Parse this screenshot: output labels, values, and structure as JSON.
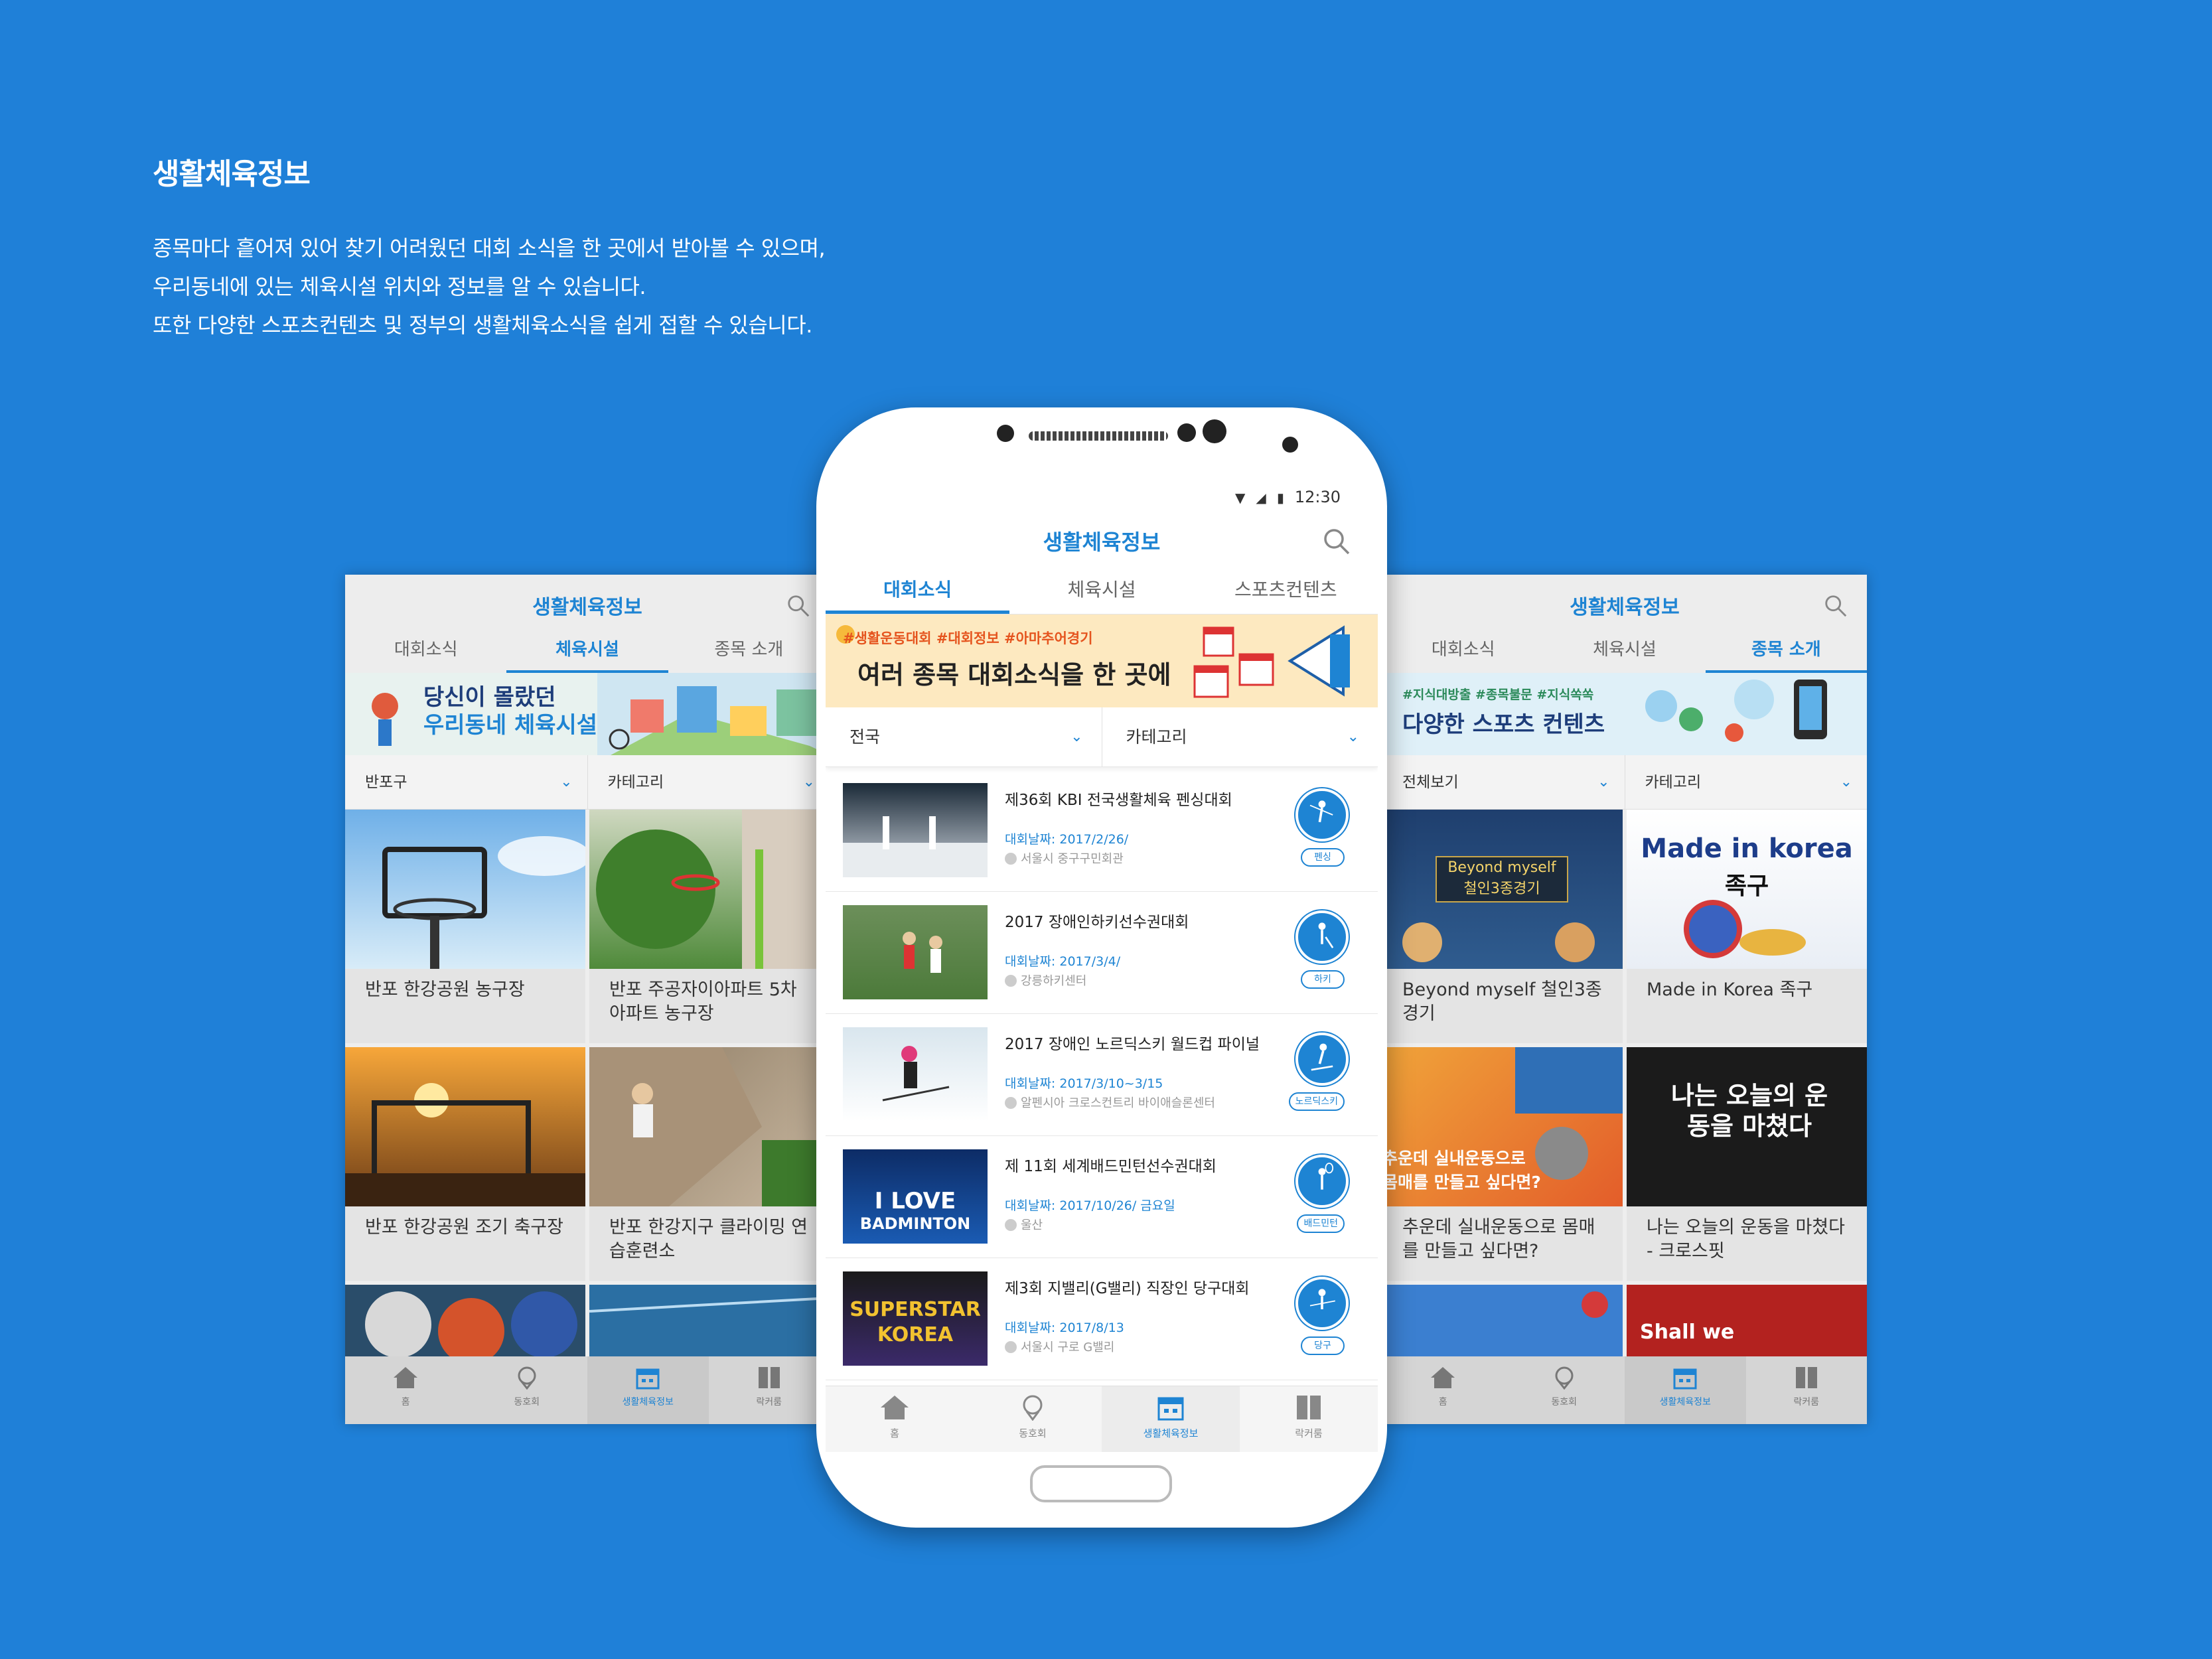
{
  "intro": {
    "title": "생활체육정보",
    "lines": [
      "종목마다 흩어져 있어 찾기 어려웠던 대회 소식을 한 곳에서 받아볼 수 있으며,",
      "우리동네에 있는 체육시설 위치와 정보를 알 수 있습니다.",
      "또한 다양한 스포츠컨텐츠 및 정부의 생활체육소식을 쉽게 접할 수 있습니다."
    ]
  },
  "left_screen": {
    "title": "생활체육정보",
    "tabs": [
      "대회소식",
      "체육시설",
      "종목 소개"
    ],
    "active_tab": 1,
    "banner_text": [
      "당신이 몰랐던",
      "우리동네 체육시설"
    ],
    "filters": [
      "반포구",
      "카테고리"
    ],
    "cards": [
      {
        "caption": "반포 한강공원 농구장"
      },
      {
        "caption": "반포 주공자이아파트 5차 아파트 농구장"
      },
      {
        "caption": "반포 한강공원 조기 축구장"
      },
      {
        "caption": "반포 한강지구 클라이밍 연습훈련소"
      }
    ],
    "nav": [
      "홈",
      "동호회",
      "생활체육정보",
      "락커룸"
    ]
  },
  "right_screen": {
    "title": "생활체육정보",
    "tabs": [
      "대회소식",
      "체육시설",
      "종목 소개"
    ],
    "active_tab": 2,
    "banner_tags": "#지식대방출 #종목불문 #지식쏙쏙",
    "banner_text": "다양한 스포츠 컨텐츠",
    "filters": [
      "전체보기",
      "카테고리"
    ],
    "cards": [
      {
        "caption": "Beyond myself 철인3종경기",
        "img_title": "Beyond myself",
        "img_sub": "철인3종경기"
      },
      {
        "caption": "Made in Korea 족구",
        "img_title": "Made in korea",
        "img_sub": "족구"
      },
      {
        "caption": "추운데 실내운동으로 몸매를 만들고 싶다면?",
        "img_text": "추운데 실내운동으로 몸매를 만들고 싶다면?"
      },
      {
        "caption": "나는 오늘의 운동을 마쳤다 - 크로스핏",
        "img_text": "나는 오늘의 운동을 마쳤다"
      }
    ],
    "partial_texts": [
      "Shall we"
    ],
    "nav": [
      "홈",
      "동호회",
      "생활체육정보",
      "락커룸"
    ]
  },
  "main_screen": {
    "status_time": "12:30",
    "title": "생활체육정보",
    "tabs": [
      "대회소식",
      "체육시설",
      "스포츠컨텐츠"
    ],
    "active_tab": 0,
    "banner_tags": "#생활운동대회 #대회정보 #아마추어경기",
    "banner_text": "여러 종목 대회소식을 한 곳에",
    "filters": [
      "전국",
      "카테고리"
    ],
    "events": [
      {
        "title": "제36회 KBI 전국생활체육 펜싱대회",
        "date": "대회날짜: 2017/2/26/",
        "location": "서울시 중구구민회관",
        "sport": "펜싱"
      },
      {
        "title": "2017 장애인하키선수권대회",
        "date": "대회날짜: 2017/3/4/",
        "location": "강릉하키센터",
        "sport": "하키"
      },
      {
        "title": "2017 장애인 노르딕스키 월드컵 파이널",
        "date": "대회날짜: 2017/3/10~3/15",
        "location": "알펜시아 크로스컨트리 바이애슬론센터",
        "sport": "노르딕스키"
      },
      {
        "title": "제 11회 세계배드민턴선수권대회",
        "date": "대회날짜: 2017/10/26/ 금요일",
        "location": "울산",
        "sport": "배드민턴",
        "thumb_text": [
          "I LOVE",
          "BADMINTON"
        ]
      },
      {
        "title": "제3회 지밸리(G밸리) 직장인 당구대회",
        "date": "대회날짜: 2017/8/13",
        "location": "서울시 구로 G밸리",
        "sport": "당구",
        "thumb_text": [
          "SUPERSTAR",
          "KOREA"
        ]
      }
    ],
    "nav": [
      "홈",
      "동호회",
      "생활체육정보",
      "락커룸"
    ]
  }
}
